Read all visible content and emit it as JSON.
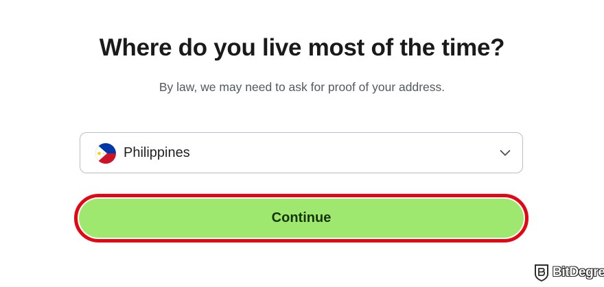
{
  "page": {
    "title": "Where do you live most of the time?",
    "subtitle": "By law, we may need to ask for proof of your address."
  },
  "country_select": {
    "selected_value": "Philippines",
    "flag_icon": "philippines-flag-icon",
    "dropdown_icon": "chevron-down-icon"
  },
  "continue_button": {
    "label": "Continue",
    "background_color": "#9fe870",
    "highlight_border_color": "#e30613"
  },
  "watermark": {
    "text": "BitDegree",
    "logo": "bitdegree-logo"
  }
}
